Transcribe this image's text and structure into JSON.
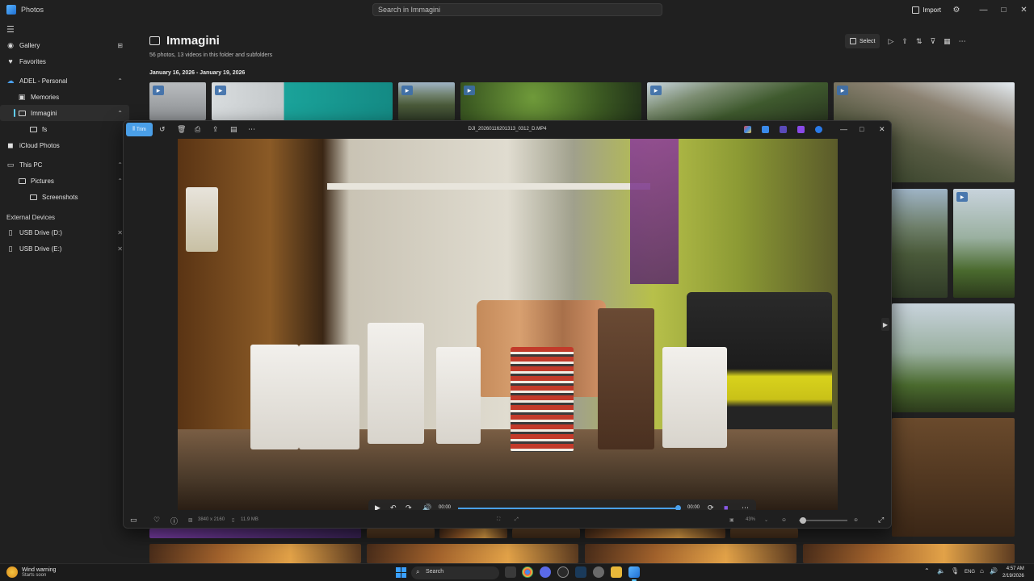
{
  "app": {
    "title": "Photos",
    "search_placeholder": "Search in Immagini",
    "import_label": "Import"
  },
  "window_controls": {
    "minimize": "—",
    "maximize": "□",
    "close": "✕"
  },
  "sidebar": {
    "items": [
      {
        "label": "Gallery"
      },
      {
        "label": "Favorites"
      },
      {
        "label": "ADEL - Personal"
      },
      {
        "label": "Memories"
      },
      {
        "label": "Immagini"
      },
      {
        "label": "fs"
      },
      {
        "label": "iCloud Photos"
      },
      {
        "label": "This PC"
      },
      {
        "label": "Pictures"
      },
      {
        "label": "Screenshots"
      }
    ],
    "external_label": "External Devices",
    "drives": [
      {
        "label": "USB Drive (D:)"
      },
      {
        "label": "USB Drive (E:)"
      }
    ]
  },
  "main": {
    "title": "Immagini",
    "subtitle": "56 photos, 13 videos in this folder and subfolders",
    "date_range": "January 16, 2026 - January 19, 2026",
    "select_label": "Select"
  },
  "viewer": {
    "trim_label": "Trim",
    "filename": "DJI_20260116201313_0312_D.MP4",
    "player": {
      "current_time": "00:00",
      "end_time": "00:00",
      "progress_fraction": 1.0
    },
    "dimensions": "3840 x 2160",
    "file_size": "11.9 MB",
    "zoom": "43%",
    "zoom_fraction": 0.08
  },
  "taskbar": {
    "weather_title": "Wind warning",
    "weather_sub": "Starts soon",
    "search_label": "Search",
    "language": "ENG",
    "time": "4:57 AM",
    "date": "2/19/2026"
  },
  "colors": {
    "accent": "#60cdff",
    "trim_button": "#4a9fe8",
    "progress": "#4aa0ec"
  }
}
